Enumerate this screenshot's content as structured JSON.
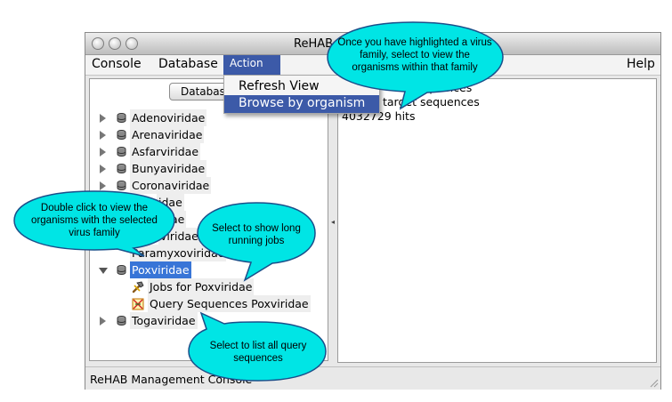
{
  "window": {
    "title": "ReHAB"
  },
  "menubar": {
    "items": [
      "Console",
      "Database",
      "Action"
    ],
    "help": "Help"
  },
  "action_menu": {
    "items": [
      "Refresh View",
      "Browse by organism"
    ],
    "selected": "Browse by organism"
  },
  "left_panel": {
    "db_button": "Database",
    "tree": [
      {
        "label": "Adenoviridae",
        "expanded": false
      },
      {
        "label": "Arenaviridae",
        "expanded": false
      },
      {
        "label": "Asfarviridae",
        "expanded": false
      },
      {
        "label": "Bunyaviridae",
        "expanded": false
      },
      {
        "label": "Coronaviridae",
        "expanded": false
      },
      {
        "label": "idae",
        "expanded": false
      },
      {
        "label": "ae",
        "expanded": false
      },
      {
        "label": "viridae",
        "expanded": false
      },
      {
        "label": "Paramyxoviridae",
        "expanded": false
      },
      {
        "label": "Poxviridae",
        "expanded": true,
        "selected": true
      },
      {
        "label": "Jobs for Poxviridae",
        "child": true,
        "icon": "jobs-hammer-icon"
      },
      {
        "label": "Query Sequences Poxviridae",
        "child": true,
        "icon": "query-sequences-icon"
      },
      {
        "label": "Togaviridae",
        "expanded": false
      }
    ]
  },
  "right_panel": {
    "lines": [
      "equences",
      "target sequences",
      "4032729 hits"
    ]
  },
  "status": {
    "text": "ReHAB Management Console"
  },
  "callouts": {
    "action": "Once you have highlighted a virus family, select to view the organisms within that family",
    "double_click": "Double click to view the organisms with the selected virus family",
    "jobs": "Select to show long running jobs",
    "query": "Select to list all query sequences"
  },
  "colors": {
    "menu_highlight": "#3c5aa8",
    "tree_selection": "#3875d7",
    "callout_fill": "#00e5e5"
  }
}
